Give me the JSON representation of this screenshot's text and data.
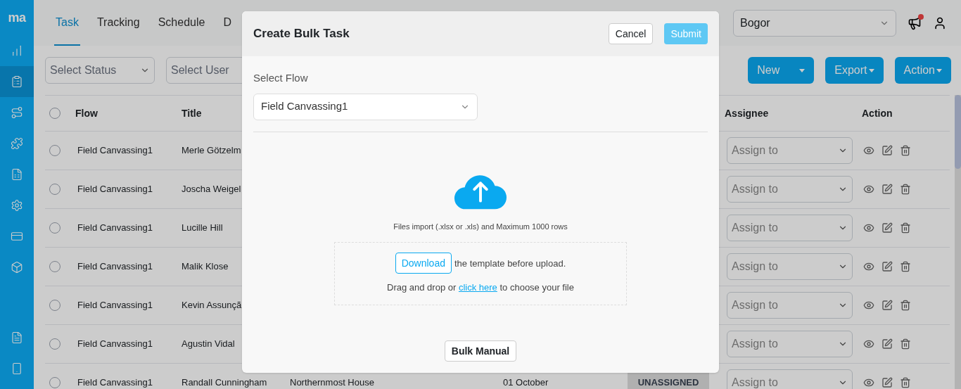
{
  "sidebar": {
    "logo": "ma",
    "items": [
      {
        "selected": false
      },
      {
        "selected": true
      },
      {
        "selected": false
      },
      {
        "selected": false
      },
      {
        "selected": false
      },
      {
        "selected": false
      },
      {
        "selected": false
      },
      {
        "selected": false
      }
    ],
    "bottom_items": [
      {
        "selected": false
      },
      {
        "selected": false
      }
    ]
  },
  "tabs": [
    {
      "label": "Task",
      "selected": true
    },
    {
      "label": "Tracking",
      "selected": false
    },
    {
      "label": "Schedule",
      "selected": false
    },
    {
      "label": "D",
      "selected": false
    }
  ],
  "region_select": {
    "value": "Bogor"
  },
  "notifications": {
    "unread": true
  },
  "filters": [
    {
      "placeholder": "Select Status"
    },
    {
      "placeholder": "Select User"
    }
  ],
  "actions": [
    {
      "label": "New",
      "kind": "split"
    },
    {
      "label": "Export",
      "kind": "dropdown"
    },
    {
      "label": "Action",
      "kind": "dropdown"
    }
  ],
  "table": {
    "header_checked": false,
    "columns": [
      "Flow",
      "Title",
      "Assignee",
      "Action"
    ],
    "rows": [
      {
        "checked": false,
        "flow": "Field Canvassing1",
        "title": "Merle Götzelm",
        "assignee": "Assign to"
      },
      {
        "checked": false,
        "flow": "Field Canvassing1",
        "title": "Joscha Weigel",
        "assignee": "Assign to"
      },
      {
        "checked": false,
        "flow": "Field Canvassing1",
        "title": "Lucille Hill",
        "assignee": "Assign to"
      },
      {
        "checked": false,
        "flow": "Field Canvassing1",
        "title": "Malik Klose",
        "assignee": "Assign to"
      },
      {
        "checked": false,
        "flow": "Field Canvassing1",
        "title": "Kevin Assunçã",
        "assignee": "Assign to"
      },
      {
        "checked": false,
        "flow": "Field Canvassing1",
        "title": "Agustin Vidal",
        "assignee": "Assign to"
      },
      {
        "checked": false,
        "flow": "Field Canvassing1",
        "title": "Randall Cunningham",
        "description": "Northernmost House",
        "date": "01 October",
        "status": "UNASSIGNED",
        "assignee": "Assign to"
      }
    ]
  },
  "modal": {
    "title": "Create Bulk Task",
    "cancel": "Cancel",
    "submit": "Submit",
    "submit_disabled": true,
    "flow_label": "Select Flow",
    "flow_value": "Field Canvassing1",
    "hint": "Files import (.xlsx or .xls) and Maximum 1000 rows",
    "download": "Download",
    "download_text": "the template before upload.",
    "drop_before": "Drag and drop or",
    "drop_link": "click here",
    "drop_after": "to choose your file",
    "manual": "Bulk Manual"
  }
}
